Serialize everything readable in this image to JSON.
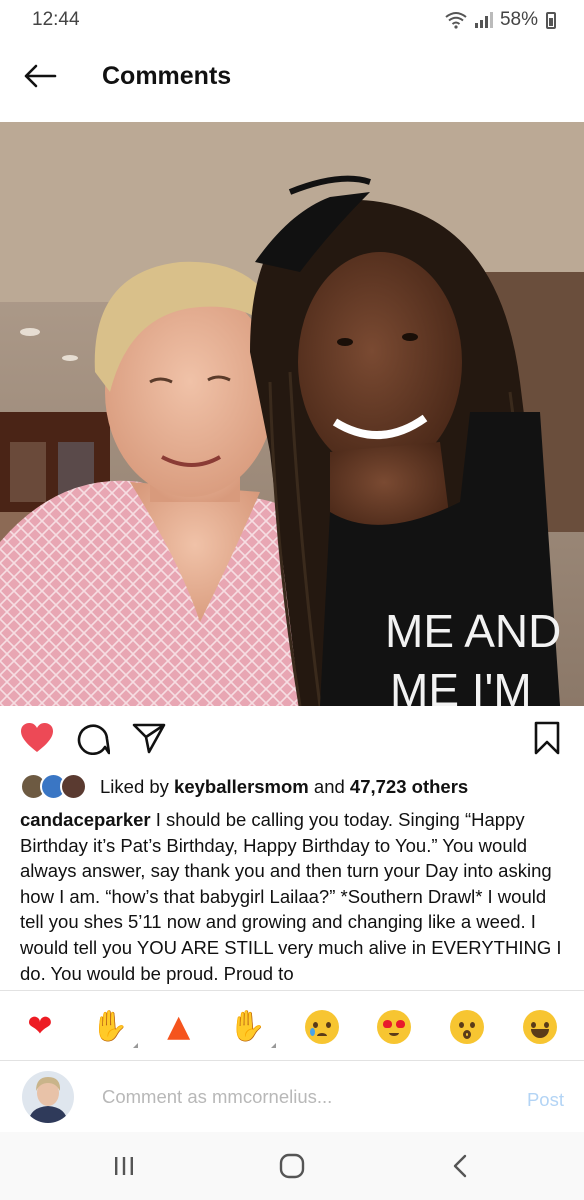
{
  "status_bar": {
    "time": "12:44",
    "battery": "58%",
    "icons": [
      "wifi-icon",
      "signal-icon",
      "battery-icon"
    ]
  },
  "header": {
    "title": "Comments",
    "back_icon": "arrow-left-icon"
  },
  "post": {
    "photo_shirt_text": "ME AND",
    "photo_shirt_text_2": "ME I'M",
    "actions": {
      "like_icon": "heart-filled-icon",
      "comment_icon": "comment-icon",
      "share_icon": "send-icon",
      "save_icon": "bookmark-icon",
      "like_color": "#ed4956"
    },
    "likes": {
      "prefix": "Liked by ",
      "user": "keyballersmom",
      "middle": " and ",
      "count": "47,723 others"
    },
    "caption": {
      "username": "candaceparker",
      "text": " I should be calling you today. Singing “Happy Birthday it’s Pat’s Birthday, Happy Birthday to You.” You would always answer, say thank you and then turn your Day into asking how I am. “how’s that babygirl Lailaa?” *Southern Drawl* I would tell you shes 5’11 now and growing and changing like a weed. I would tell you YOU ARE STILL very much alive in EVERYTHING I do. You would be proud. Proud to"
    }
  },
  "emoji_bar": [
    "red-heart",
    "raising-hands",
    "fire",
    "clapping-hands",
    "crying-face",
    "heart-eyes-face",
    "hushed-face",
    "tears-of-joy-face"
  ],
  "comment_box": {
    "placeholder": "Comment as mmcornelius...",
    "post_label": "Post",
    "post_color": "#b3d4f5"
  },
  "nav_bar": [
    "recent-apps-icon",
    "home-icon",
    "back-icon"
  ]
}
